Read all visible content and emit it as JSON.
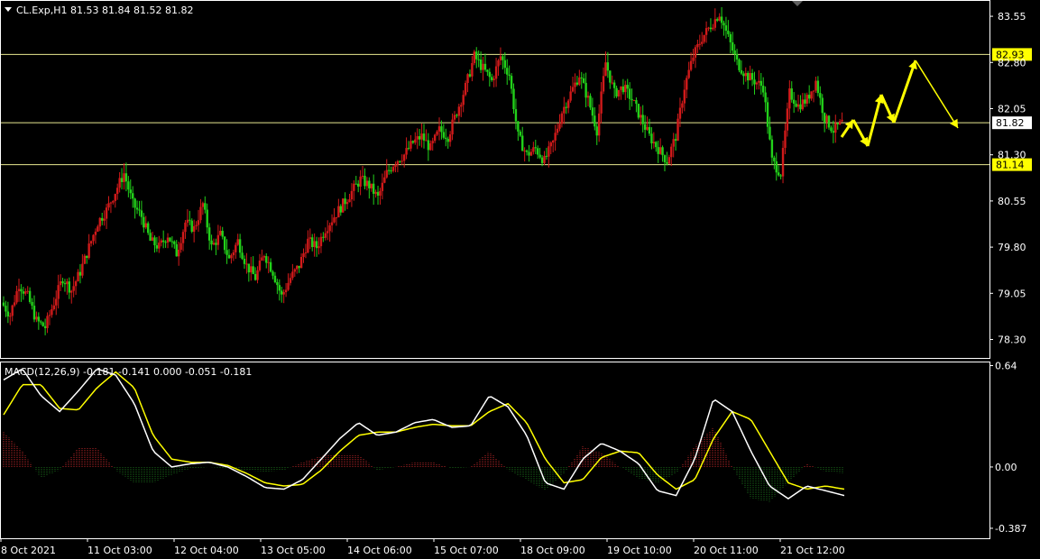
{
  "symbol_info": "CL.Exp,H1  81.53 81.84 81.52 81.82",
  "chart_data": [
    {
      "type": "candlestick",
      "title": "CL.Exp,H1  81.53 81.84 81.52 81.82",
      "ylim": [
        78.0,
        83.8
      ],
      "y_ticks": [
        "83.55",
        "82.80",
        "82.05",
        "81.30",
        "80.55",
        "79.80",
        "79.05",
        "78.30"
      ],
      "horizontal_levels": [
        {
          "value": 82.93,
          "label": "82.93",
          "highlight": true
        },
        {
          "value": 81.82,
          "label": "81.82",
          "highlight": false
        },
        {
          "value": 81.14,
          "label": "81.14",
          "highlight": true
        }
      ],
      "x_tick_labels": [
        "8 Oct 2021",
        "11 Oct 03:00",
        "12 Oct 04:00",
        "13 Oct 05:00",
        "14 Oct 06:00",
        "15 Oct 07:00",
        "18 Oct 09:00",
        "19 Oct 10:00",
        "20 Oct 11:00",
        "21 Oct 12:00"
      ],
      "close_path": [
        78.9,
        78.7,
        79.2,
        79.0,
        78.6,
        78.5,
        78.9,
        79.3,
        79.1,
        79.4,
        79.8,
        80.2,
        80.4,
        80.7,
        81.0,
        80.5,
        80.3,
        79.9,
        79.8,
        80.0,
        79.7,
        80.2,
        80.1,
        80.5,
        79.8,
        80.0,
        79.6,
        79.9,
        79.5,
        79.3,
        79.7,
        79.4,
        79.0,
        79.3,
        79.5,
        79.9,
        79.8,
        80.1,
        80.3,
        80.5,
        80.7,
        80.9,
        80.8,
        80.6,
        81.0,
        81.2,
        81.3,
        81.5,
        81.6,
        81.4,
        81.7,
        81.6,
        82.0,
        82.4,
        82.9,
        82.7,
        82.5,
        82.9,
        82.6,
        81.6,
        81.3,
        81.4,
        81.2,
        81.5,
        82.0,
        82.3,
        82.6,
        82.2,
        81.7,
        82.8,
        82.3,
        82.4,
        82.2,
        81.9,
        81.6,
        81.4,
        81.2,
        81.6,
        82.4,
        82.9,
        83.2,
        83.4,
        83.6,
        83.2,
        82.8,
        82.6,
        82.5,
        82.4,
        81.2,
        81.0,
        82.3,
        82.1,
        82.2,
        82.5,
        81.9,
        81.7,
        81.82
      ],
      "macd": {
        "label": "MACD(12,26,9) -0.181 -0.141 0.000 -0.051 -0.181",
        "ylim": [
          -0.45,
          0.66
        ],
        "y_ticks": [
          "0.64",
          "0.00",
          "-0.387"
        ],
        "main_line": [
          0.55,
          0.62,
          0.45,
          0.35,
          0.48,
          0.62,
          0.58,
          0.4,
          0.1,
          0.0,
          0.02,
          0.03,
          0.0,
          -0.06,
          -0.13,
          -0.14,
          -0.08,
          0.05,
          0.18,
          0.28,
          0.2,
          0.22,
          0.28,
          0.3,
          0.25,
          0.26,
          0.45,
          0.38,
          0.2,
          -0.1,
          -0.14,
          0.05,
          0.15,
          0.1,
          0.02,
          -0.15,
          -0.18,
          0.05,
          0.43,
          0.35,
          0.1,
          -0.12,
          -0.2,
          -0.12,
          -0.15,
          -0.18
        ],
        "signal_line": [
          0.33,
          0.52,
          0.52,
          0.37,
          0.36,
          0.5,
          0.6,
          0.5,
          0.2,
          0.05,
          0.03,
          0.03,
          0.01,
          -0.04,
          -0.1,
          -0.12,
          -0.11,
          -0.02,
          0.1,
          0.2,
          0.22,
          0.22,
          0.25,
          0.27,
          0.26,
          0.26,
          0.35,
          0.4,
          0.28,
          0.05,
          -0.1,
          -0.08,
          0.06,
          0.1,
          0.09,
          -0.05,
          -0.14,
          -0.08,
          0.18,
          0.35,
          0.3,
          0.1,
          -0.1,
          -0.14,
          -0.12,
          -0.14
        ],
        "histogram": [
          0.22,
          0.1,
          -0.07,
          -0.02,
          0.12,
          0.12,
          -0.02,
          -0.1,
          -0.1,
          -0.05,
          -0.01,
          0.0,
          -0.01,
          -0.02,
          -0.03,
          -0.02,
          0.03,
          0.07,
          0.08,
          0.08,
          -0.02,
          0.0,
          0.03,
          0.03,
          -0.01,
          0.0,
          0.1,
          -0.02,
          -0.08,
          -0.15,
          -0.04,
          0.13,
          0.09,
          0.0,
          -0.07,
          -0.1,
          -0.04,
          0.13,
          0.25,
          0.0,
          -0.2,
          -0.22,
          -0.1,
          0.02,
          -0.03,
          -0.04
        ]
      }
    }
  ],
  "colors": {
    "background": "#000000",
    "grid_border": "#ffffff",
    "bull": "#d11a1a",
    "bear": "#22d11a",
    "level_line": "#e8e890",
    "level_box": "#ffff00",
    "forecast": "#ffff00",
    "macd_main": "#ffffff",
    "macd_signal": "#ffff00",
    "hist_pos": "#c0282a",
    "hist_neg": "#1a6b1a"
  }
}
